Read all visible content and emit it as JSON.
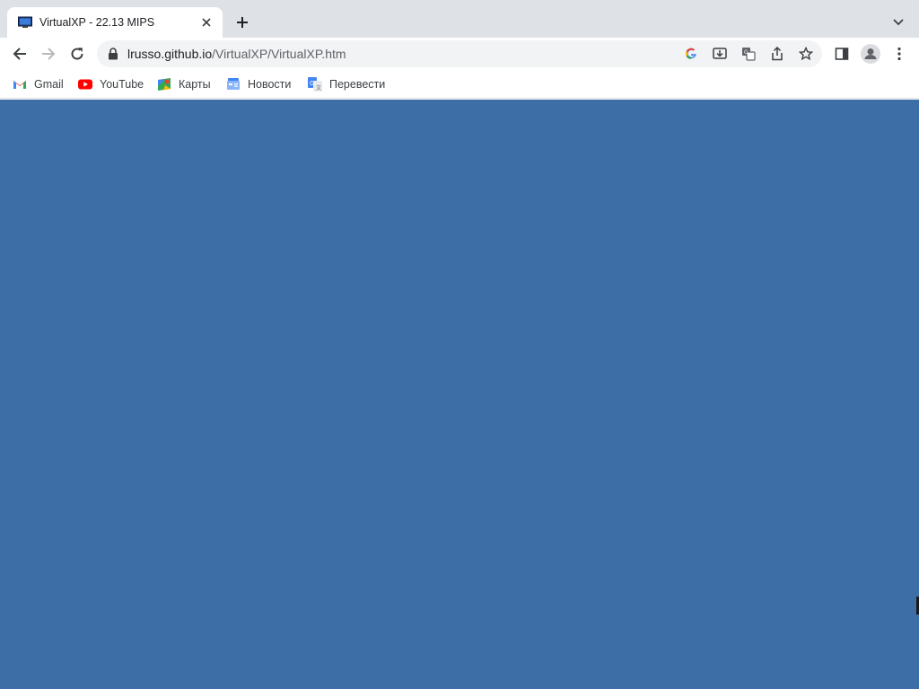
{
  "tab": {
    "title": "VirtualXP - 22.13 MIPS",
    "favicon": "monitor-icon"
  },
  "toolbar": {
    "url_host": "lrusso.github.io",
    "url_path": "/VirtualXP/VirtualXP.htm",
    "icons": [
      "back-icon",
      "forward-icon",
      "reload-icon",
      "lock-icon",
      "google-icon",
      "install-icon",
      "translate-icon",
      "share-icon",
      "star-icon",
      "side-panel-icon",
      "profile-icon",
      "menu-icon"
    ]
  },
  "bookmarks": [
    {
      "label": "Gmail",
      "icon": "gmail-icon"
    },
    {
      "label": "YouTube",
      "icon": "youtube-icon"
    },
    {
      "label": "Карты",
      "icon": "maps-icon"
    },
    {
      "label": "Новости",
      "icon": "news-icon"
    },
    {
      "label": "Перевести",
      "icon": "translate-icon"
    }
  ],
  "colors": {
    "page_background": "#3d6ea5",
    "tabstrip": "#dee1e6",
    "omnibox": "#f1f3f4"
  }
}
